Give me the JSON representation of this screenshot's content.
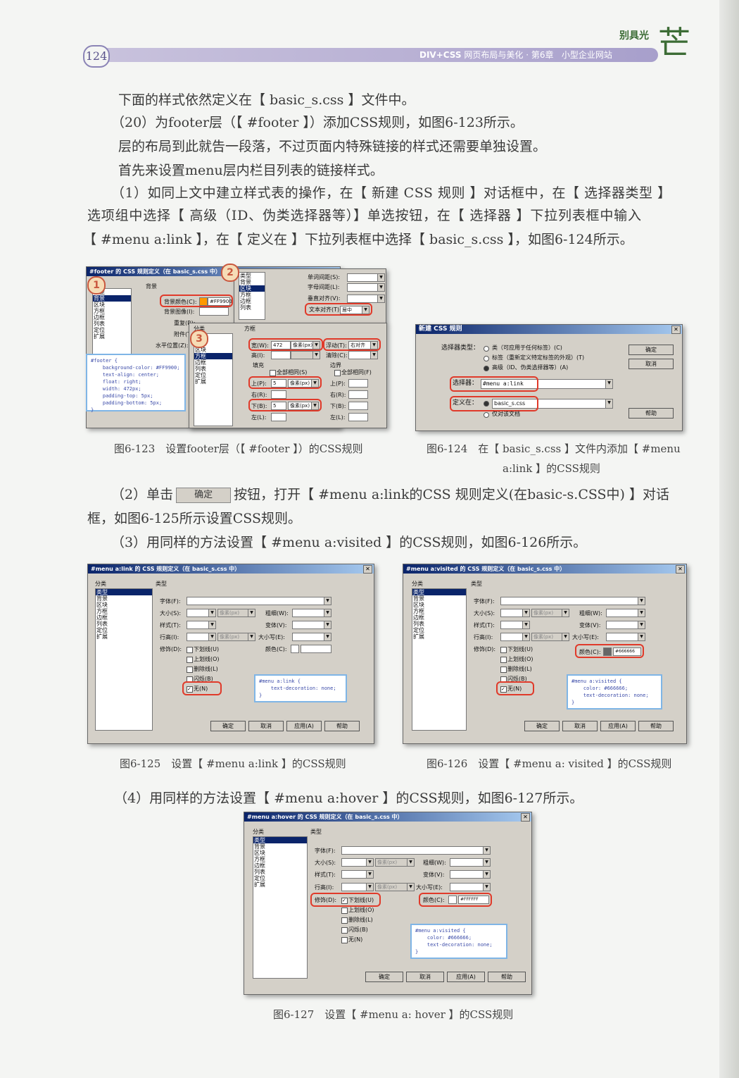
{
  "header": {
    "page_number": "124",
    "brand": "DIV+CSS",
    "title": "网页布局与美化 · 第6章",
    "chapter": "小型企业网站",
    "logo_small": "别具光",
    "logo_big": "芒"
  },
  "paragraphs": [
    "下面的样式依然定义在【 basic_s.css 】文件中。",
    "（20）为footer层（【 #footer 】）添加CSS规则，如图6-123所示。",
    "层的布局到此就告一段落，不过页面内特殊链接的样式还需要单独设置。",
    "首先来设置menu层内栏目列表的链接样式。",
    "（1）如同上文中建立样式表的操作，在【 新建 CSS 规则 】对话框中，在【 选择器类型 】",
    "选项组中选择【 高级（ID、伪类选择器等）】单选按钮，在【 选择器 】下拉列表框中输入",
    "【 #menu a:link 】，在【 定义在 】下拉列表框中选择【 basic_s.css 】，如图6-124所示。"
  ],
  "para_step2_a": "（2）单击",
  "para_step2_btn": "确定",
  "para_step2_b": "按钮，打开【 #menu a:link的CSS 规则定义(在basic-s.CSS中) 】对话",
  "para_step2_c": "框，如图6-125所示设置CSS规则。",
  "para_step3": "（3）用同样的方法设置【 #menu a:visited 】的CSS规则，如图6-126所示。",
  "para_step4": "（4）用同样的方法设置【 #menu a:hover 】的CSS规则，如图6-127所示。",
  "captions": {
    "fig123": "图6-123　设置footer层（【 #footer 】）的CSS规则",
    "fig124_a": "图6-124　在【 basic_s.css 】文件内添加【 #menu",
    "fig124_b": "a:link 】的CSS规则",
    "fig125": "图6-125　设置【 #menu a:link 】的CSS规则",
    "fig126": "图6-126　设置【 #menu a: visited 】的CSS规则",
    "fig127": "图6-127　设置【 #menu a: hover 】的CSS规则"
  },
  "fig123": {
    "title1": "#footer 的 CSS 规则定义（在 basic_s.css 中）",
    "section_bg": "背景",
    "bg_color_label": "背景颜色(C):",
    "bg_color_value": "#FF9900",
    "bg_image_label": "背景图像(I):",
    "repeat_label": "重复(R):",
    "attach_label": "附件(T):",
    "hpos_label": "水平位置(Z):",
    "word_spacing": "单词间距(S):",
    "letter_spacing": "字母间距(L):",
    "vertical_align": "垂直对齐(V):",
    "text_align_label": "文本对齐(T):",
    "text_align_value": "居中",
    "cat_header": "分类",
    "box_header": "方框",
    "width_label": "宽(W):",
    "width_value": "472",
    "height_label": "高(I):",
    "unit_px": "像素(px)",
    "float_label": "浮动(T):",
    "float_value": "右对齐",
    "clear_label": "清除(C):",
    "padding_label": "填充",
    "margin_label": "边界",
    "same_all": "全部相同(S)",
    "same_all2": "全部相同(F)",
    "top_label": "上(P):",
    "top_value": "5",
    "right_label": "右(R):",
    "bottom_label": "下(B):",
    "bottom_value": "5",
    "left_label": "左(L):",
    "categories": [
      "类型",
      "背景",
      "区块",
      "方框",
      "边框",
      "列表",
      "定位",
      "扩展"
    ],
    "code": "#footer {\n    background-color: #FF9900;\n    text-align: center;\n    float: right;\n    width: 472px;\n    padding-top: 5px;\n    padding-bottom: 5px;\n}",
    "badges": [
      "1",
      "2",
      "3"
    ]
  },
  "fig124": {
    "title": "新建 CSS 规则",
    "selector_type": "选择器类型：",
    "opt1": "类（可应用于任何标签）(C)",
    "opt2": "标签（重新定义特定标签的外观）(T)",
    "opt3": "高级（ID、伪类选择器等）(A)",
    "selector_label": "选择器：",
    "selector_value": "#menu a:link",
    "define_in": "定义在：",
    "define_value": "basic_s.css",
    "doc_only": "仅对该文档",
    "ok": "确定",
    "cancel": "取消",
    "help": "帮助"
  },
  "type_panel": {
    "cat_header": "分类",
    "type_header": "类型",
    "categories": [
      "类型",
      "背景",
      "区块",
      "方框",
      "边框",
      "列表",
      "定位",
      "扩展"
    ],
    "font": "字体(F):",
    "size": "大小(S):",
    "style": "样式(T):",
    "line_height": "行高(I):",
    "decoration": "修饰(D):",
    "weight": "粗细(W):",
    "variant": "变体(V):",
    "case": "大小写(E):",
    "color": "颜色(C):",
    "underline": "下划线(U)",
    "overline": "上划线(O)",
    "strike": "删除线(L)",
    "blink": "闪烁(B)",
    "none": "无(N)",
    "unit_px": "像素(px)",
    "ok": "确定",
    "cancel": "取消",
    "apply": "应用(A)",
    "help": "帮助"
  },
  "fig125": {
    "title": "#menu a:link 的 CSS 规则定义（在 basic_s.css 中）",
    "code": "#menu a:link {\n    text-decoration: none;\n}"
  },
  "fig126": {
    "title": "#menu a:visited 的 CSS 规则定义（在 basic_s.css 中）",
    "color_value": "#666666",
    "code": "#menu a:visited {\n    color: #666666;\n    text-decoration: none;\n}"
  },
  "fig127": {
    "title": "#menu a:hover 的 CSS 规则定义（在 basic_s.css 中）",
    "color_value": "#FFFFFF",
    "code": "#menu a:visited {\n    color: #666666;\n    text-decoration: none;\n}"
  }
}
